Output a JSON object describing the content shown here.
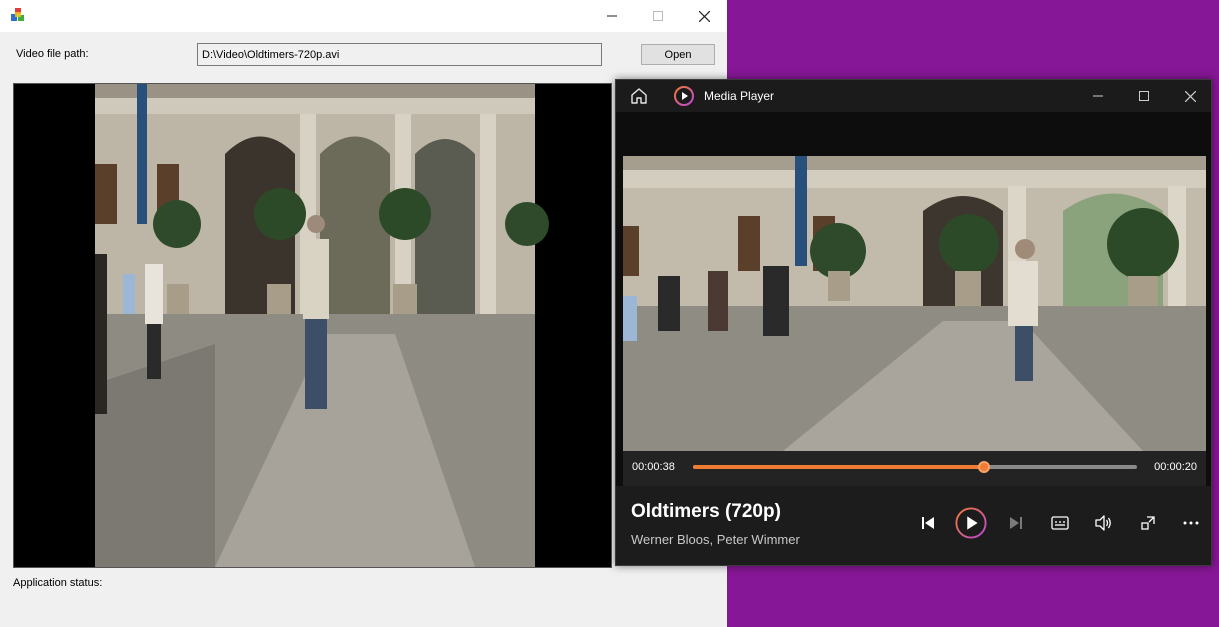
{
  "colors": {
    "desktop": "#861796",
    "accent": "#f07c33",
    "accent_ring": "#c046d6"
  },
  "app_window": {
    "title": "",
    "path_label": "Video file path:",
    "path_value": "D:\\Video\\Oldtimers-720p.avi",
    "open_button": "Open",
    "status_label": "Application status:"
  },
  "media_player": {
    "app_name": "Media Player",
    "time_elapsed": "00:00:38",
    "time_remaining": "00:00:20",
    "progress": 0.655,
    "media_title": "Oldtimers (720p)",
    "media_artist": "Werner Bloos, Peter Wimmer",
    "icons": [
      "home-icon",
      "media-player-logo-icon",
      "minimize-icon",
      "maximize-icon",
      "close-icon",
      "previous-icon",
      "play-icon",
      "next-icon",
      "subtitles-icon",
      "volume-icon",
      "mini-player-icon",
      "more-icon"
    ]
  }
}
